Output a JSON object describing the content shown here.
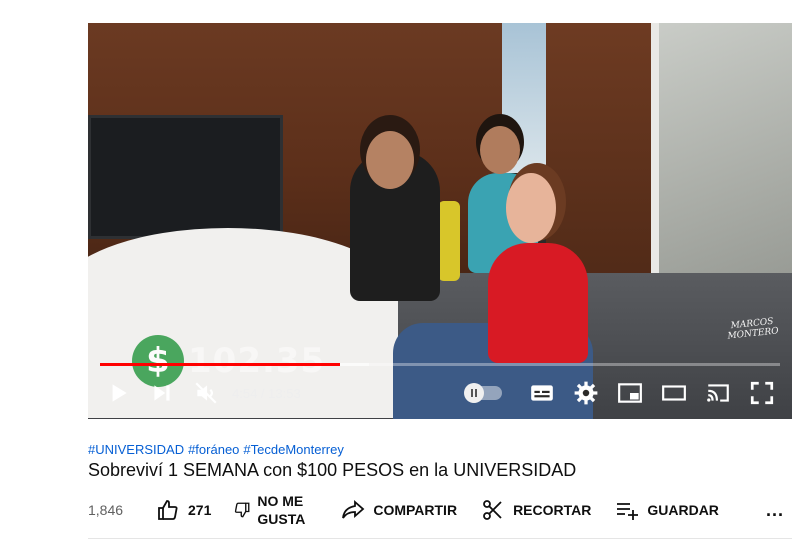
{
  "player": {
    "overlay_currency_symbol": "$",
    "overlay_amount": "102.35",
    "watermark": "MARCOS\nMONTERO",
    "current_time": "4:54",
    "duration": "13:53",
    "time_display": "4:54 / 13:53",
    "progress_played_fraction": 0.353,
    "progress_buffered_fraction": 0.395,
    "controls": {
      "play": "play-icon",
      "next": "next-icon",
      "volume": "volume-muted-icon",
      "autoplay": "autoplay-toggle",
      "subtitles": "subtitles-icon",
      "settings": "gear-icon",
      "miniplayer": "miniplayer-icon",
      "theater": "theater-mode-icon",
      "cast": "cast-icon",
      "fullscreen": "fullscreen-icon"
    }
  },
  "video": {
    "hashtags": [
      "#UNIVERSIDAD",
      "#foráneo",
      "#TecdeMonterrey"
    ],
    "title": "Sobreviví 1 SEMANA con $100 PESOS en la UNIVERSIDAD"
  },
  "actions": {
    "views": "1,846",
    "like_count": "271",
    "dislike_label_line1": "NO ME",
    "dislike_label_line2": "GUSTA",
    "share_label": "COMPARTIR",
    "clip_label": "RECORTAR",
    "save_label": "GUARDAR",
    "more_label": "..."
  },
  "colors": {
    "progress": "#ff0000",
    "hashtag": "#065fd4",
    "text": "#0f0f0f"
  }
}
